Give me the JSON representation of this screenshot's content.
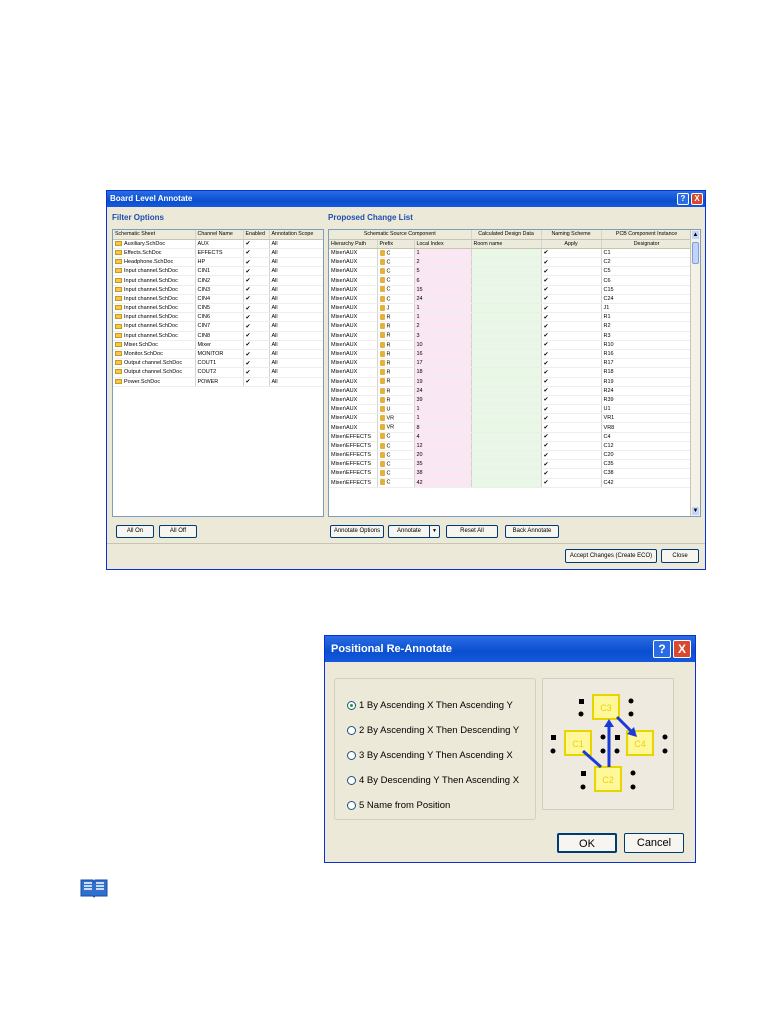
{
  "board_annotate": {
    "title": "Board Level Annotate",
    "help_icon": "?",
    "close_icon": "X",
    "filter": {
      "heading": "Filter Options",
      "columns": [
        "Schematic Sheet",
        "Channel Name",
        "Enabled",
        "Annotation Scope"
      ],
      "rows": [
        {
          "sheet": "Auxiliary.SchDoc",
          "channel": "AUX",
          "enabled": "✔",
          "scope": "All"
        },
        {
          "sheet": "Effects.SchDoc",
          "channel": "EFFECTS",
          "enabled": "✔",
          "scope": "All"
        },
        {
          "sheet": "Headphone.SchDoc",
          "channel": "HP",
          "enabled": "✔",
          "scope": "All"
        },
        {
          "sheet": "Input channel.SchDoc",
          "channel": "CIN1",
          "enabled": "✔",
          "scope": "All"
        },
        {
          "sheet": "Input channel.SchDoc",
          "channel": "CIN2",
          "enabled": "✔",
          "scope": "All"
        },
        {
          "sheet": "Input channel.SchDoc",
          "channel": "CIN3",
          "enabled": "✔",
          "scope": "All"
        },
        {
          "sheet": "Input channel.SchDoc",
          "channel": "CIN4",
          "enabled": "✔",
          "scope": "All"
        },
        {
          "sheet": "Input channel.SchDoc",
          "channel": "CIN5",
          "enabled": "✔",
          "scope": "All"
        },
        {
          "sheet": "Input channel.SchDoc",
          "channel": "CIN6",
          "enabled": "✔",
          "scope": "All"
        },
        {
          "sheet": "Input channel.SchDoc",
          "channel": "CIN7",
          "enabled": "✔",
          "scope": "All"
        },
        {
          "sheet": "Input channel.SchDoc",
          "channel": "CIN8",
          "enabled": "✔",
          "scope": "All"
        },
        {
          "sheet": "Mixer.SchDoc",
          "channel": "Mixer",
          "enabled": "✔",
          "scope": "All"
        },
        {
          "sheet": "Monitor.SchDoc",
          "channel": "MONITOR",
          "enabled": "✔",
          "scope": "All"
        },
        {
          "sheet": "Output channel.SchDoc",
          "channel": "COUT1",
          "enabled": "✔",
          "scope": "All"
        },
        {
          "sheet": "Output channel.SchDoc",
          "channel": "COUT2",
          "enabled": "✔",
          "scope": "All"
        },
        {
          "sheet": "Power.SchDoc",
          "channel": "POWER",
          "enabled": "✔",
          "scope": "All"
        }
      ],
      "all_on": "All On",
      "all_off": "All Off"
    },
    "changes": {
      "heading": "Proposed Change List",
      "groups": [
        "Schematic Source Component",
        "Calculated Design Data",
        "Naming Scheme",
        "PCB Component Instance"
      ],
      "columns": [
        "Hierarchy Path",
        "Prefix",
        "Local Index",
        "Room name",
        "Apply",
        "Designator"
      ],
      "rows": [
        {
          "path": "Mixer\\AUX",
          "prefix": "C",
          "index": "1",
          "room": "",
          "apply": "✔",
          "designator": "C1"
        },
        {
          "path": "Mixer\\AUX",
          "prefix": "C",
          "index": "2",
          "room": "",
          "apply": "✔",
          "designator": "C2"
        },
        {
          "path": "Mixer\\AUX",
          "prefix": "C",
          "index": "5",
          "room": "",
          "apply": "✔",
          "designator": "C5"
        },
        {
          "path": "Mixer\\AUX",
          "prefix": "C",
          "index": "6",
          "room": "",
          "apply": "✔",
          "designator": "C6"
        },
        {
          "path": "Mixer\\AUX",
          "prefix": "C",
          "index": "15",
          "room": "",
          "apply": "✔",
          "designator": "C15"
        },
        {
          "path": "Mixer\\AUX",
          "prefix": "C",
          "index": "24",
          "room": "",
          "apply": "✔",
          "designator": "C24"
        },
        {
          "path": "Mixer\\AUX",
          "prefix": "J",
          "index": "1",
          "room": "",
          "apply": "✔",
          "designator": "J1"
        },
        {
          "path": "Mixer\\AUX",
          "prefix": "R",
          "index": "1",
          "room": "",
          "apply": "✔",
          "designator": "R1"
        },
        {
          "path": "Mixer\\AUX",
          "prefix": "R",
          "index": "2",
          "room": "",
          "apply": "✔",
          "designator": "R2"
        },
        {
          "path": "Mixer\\AUX",
          "prefix": "R",
          "index": "3",
          "room": "",
          "apply": "✔",
          "designator": "R3"
        },
        {
          "path": "Mixer\\AUX",
          "prefix": "R",
          "index": "10",
          "room": "",
          "apply": "✔",
          "designator": "R10"
        },
        {
          "path": "Mixer\\AUX",
          "prefix": "R",
          "index": "16",
          "room": "",
          "apply": "✔",
          "designator": "R16"
        },
        {
          "path": "Mixer\\AUX",
          "prefix": "R",
          "index": "17",
          "room": "",
          "apply": "✔",
          "designator": "R17"
        },
        {
          "path": "Mixer\\AUX",
          "prefix": "R",
          "index": "18",
          "room": "",
          "apply": "✔",
          "designator": "R18"
        },
        {
          "path": "Mixer\\AUX",
          "prefix": "R",
          "index": "19",
          "room": "",
          "apply": "✔",
          "designator": "R19"
        },
        {
          "path": "Mixer\\AUX",
          "prefix": "R",
          "index": "24",
          "room": "",
          "apply": "✔",
          "designator": "R24"
        },
        {
          "path": "Mixer\\AUX",
          "prefix": "R",
          "index": "39",
          "room": "",
          "apply": "✔",
          "designator": "R39"
        },
        {
          "path": "Mixer\\AUX",
          "prefix": "U",
          "index": "1",
          "room": "",
          "apply": "✔",
          "designator": "U1"
        },
        {
          "path": "Mixer\\AUX",
          "prefix": "VR",
          "index": "1",
          "room": "",
          "apply": "✔",
          "designator": "VR1"
        },
        {
          "path": "Mixer\\AUX",
          "prefix": "VR",
          "index": "8",
          "room": "",
          "apply": "✔",
          "designator": "VR8"
        },
        {
          "path": "Mixer\\EFFECTS",
          "prefix": "C",
          "index": "4",
          "room": "",
          "apply": "✔",
          "designator": "C4"
        },
        {
          "path": "Mixer\\EFFECTS",
          "prefix": "C",
          "index": "12",
          "room": "",
          "apply": "✔",
          "designator": "C12"
        },
        {
          "path": "Mixer\\EFFECTS",
          "prefix": "C",
          "index": "20",
          "room": "",
          "apply": "✔",
          "designator": "C20"
        },
        {
          "path": "Mixer\\EFFECTS",
          "prefix": "C",
          "index": "35",
          "room": "",
          "apply": "✔",
          "designator": "C35"
        },
        {
          "path": "Mixer\\EFFECTS",
          "prefix": "C",
          "index": "38",
          "room": "",
          "apply": "✔",
          "designator": "C38"
        },
        {
          "path": "Mixer\\EFFECTS",
          "prefix": "C",
          "index": "42",
          "room": "",
          "apply": "✔",
          "designator": "C42"
        }
      ],
      "buttons": {
        "annotate_options": "Annotate Options",
        "annotate": "Annotate",
        "reset_all": "Reset All",
        "back_annotate": "Back Annotate"
      }
    },
    "footer": {
      "accept": "Accept Changes (Create ECO)",
      "close": "Close"
    }
  },
  "positional": {
    "title": "Positional Re-Annotate",
    "help_icon": "?",
    "close_icon": "X",
    "options": [
      {
        "label": "1 By Ascending X Then Ascending Y",
        "selected": true
      },
      {
        "label": "2 By Ascending X Then Descending Y",
        "selected": false
      },
      {
        "label": "3 By Ascending Y Then Ascending X",
        "selected": false
      },
      {
        "label": "4 By Descending Y Then Ascending X",
        "selected": false
      },
      {
        "label": "5 Name from Position",
        "selected": false
      }
    ],
    "diagram_labels": [
      "C3",
      "C1",
      "C4",
      "C2"
    ],
    "ok": "OK",
    "cancel": "Cancel"
  },
  "note_icon": "book-icon"
}
